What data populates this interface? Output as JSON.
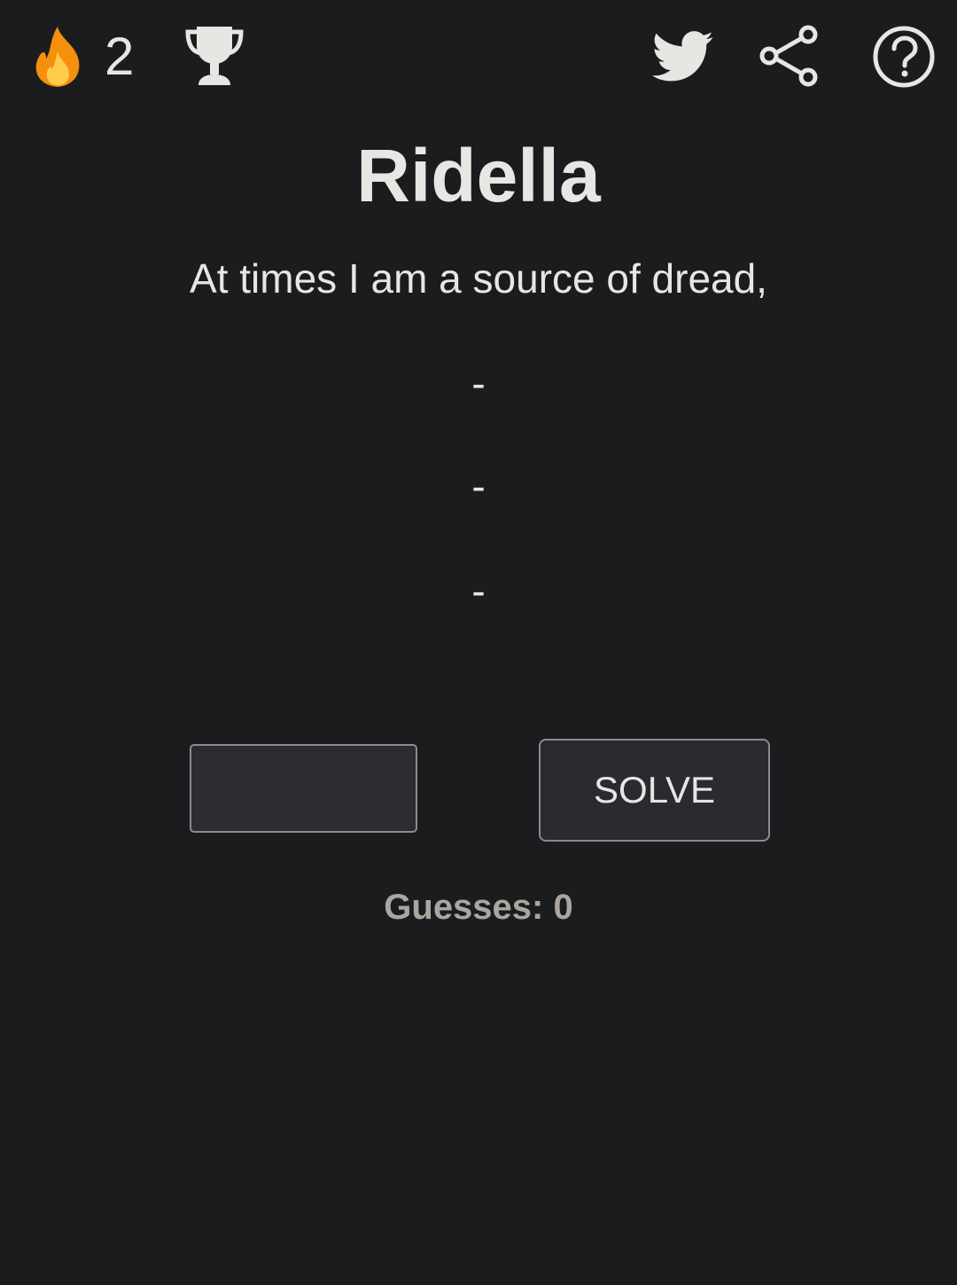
{
  "header": {
    "streak_icon": "fire-icon",
    "streak_count": "2",
    "trophy_icon": "trophy-icon",
    "twitter_icon": "twitter-icon",
    "share_icon": "share-icon",
    "help_icon": "help-icon"
  },
  "title": "Ridella",
  "riddle": {
    "lines": [
      "At times I am a source of dread,",
      "-",
      "-",
      "-"
    ]
  },
  "answer": {
    "value": "",
    "placeholder": ""
  },
  "solve_label": "SOLVE",
  "guesses_label": "Guesses: 0",
  "colors": {
    "background": "#1b1c1e",
    "text": "#e8e6e3",
    "muted_text": "#aaa69f",
    "fire_orange": "#f4900c",
    "fire_yellow": "#ffcc4d"
  }
}
